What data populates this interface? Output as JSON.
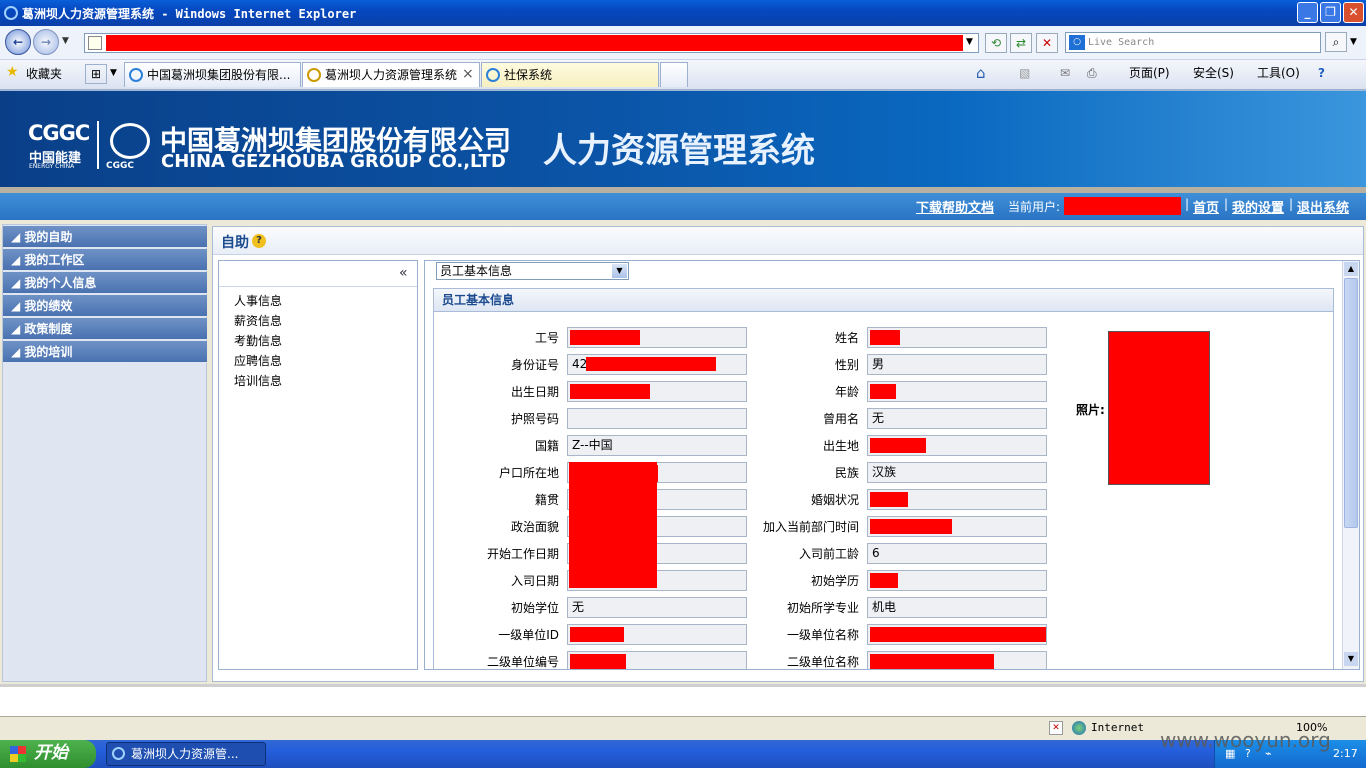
{
  "window": {
    "title": "葛洲坝人力资源管理系统 - Windows Internet Explorer",
    "minimize_icon": "minimize-icon",
    "maximize_icon": "maximize-icon",
    "close_icon": "close-icon"
  },
  "browser": {
    "search_placeholder": "Live Search",
    "favorites_label": "收藏夹",
    "tabs": [
      {
        "label": "中国葛洲坝集团股份有限..."
      },
      {
        "label": "葛洲坝人力资源管理系统"
      },
      {
        "label": "社保系统"
      }
    ],
    "tab_close": "×",
    "tools": {
      "page": "页面(P)",
      "safety": "安全(S)",
      "tools": "工具(O)"
    }
  },
  "header": {
    "logo_cgc": "CGGC",
    "energy_china_cn": "中国能建",
    "energy_china_en": "ENERGY CHINA",
    "cggc_small": "CGGC",
    "company_cn": "中国葛洲坝集团股份有限公司",
    "company_en": "CHINA GEZHOUBA GROUP CO.,LTD",
    "system_name": "人力资源管理系统"
  },
  "topnav": {
    "help_doc": "下载帮助文档",
    "current_user_label": "当前用户:",
    "home": "首页",
    "settings": "我的设置",
    "logout": "退出系统",
    "separator": "|"
  },
  "sidebar": {
    "items": [
      {
        "label": "我的自助"
      },
      {
        "label": "我的工作区"
      },
      {
        "label": "我的个人信息"
      },
      {
        "label": "我的绩效"
      },
      {
        "label": "政策制度"
      },
      {
        "label": "我的培训"
      }
    ]
  },
  "main": {
    "title": "自助",
    "collapse": "«",
    "submenu": [
      {
        "label": "人事信息"
      },
      {
        "label": "薪资信息"
      },
      {
        "label": "考勤信息"
      },
      {
        "label": "应聘信息"
      },
      {
        "label": "培训信息"
      }
    ],
    "select_value": "员工基本信息",
    "panel_title": "员工基本信息",
    "photo_label": "照片:",
    "left_fields": [
      {
        "label": "工号",
        "value": ""
      },
      {
        "label": "身份证号",
        "value": "42"
      },
      {
        "label": "出生日期",
        "value": ""
      },
      {
        "label": "护照号码",
        "value": ""
      },
      {
        "label": "国籍",
        "value": "Z--中国"
      },
      {
        "label": "户口所在地",
        "value": ""
      },
      {
        "label": "籍贯",
        "value": ""
      },
      {
        "label": "政治面貌",
        "value": ""
      },
      {
        "label": "开始工作日期",
        "value": ""
      },
      {
        "label": "入司日期",
        "value": ""
      },
      {
        "label": "初始学位",
        "value": "无"
      },
      {
        "label": "一级单位ID",
        "value": ""
      },
      {
        "label": "二级单位编号",
        "value": ""
      }
    ],
    "right_fields": [
      {
        "label": "姓名",
        "value": ""
      },
      {
        "label": "性别",
        "value": "男"
      },
      {
        "label": "年龄",
        "value": ""
      },
      {
        "label": "曾用名",
        "value": "无"
      },
      {
        "label": "出生地",
        "value": ""
      },
      {
        "label": "民族",
        "value": "汉族"
      },
      {
        "label": "婚姻状况",
        "value": ""
      },
      {
        "label": "加入当前部门时间",
        "value": ""
      },
      {
        "label": "入司前工龄",
        "value": "6"
      },
      {
        "label": "初始学历",
        "value": ""
      },
      {
        "label": "初始所学专业",
        "value": "机电"
      },
      {
        "label": "一级单位名称",
        "value": ""
      },
      {
        "label": "二级单位名称",
        "value": ""
      }
    ]
  },
  "statusbar": {
    "zone": "Internet",
    "zoom": "100%"
  },
  "taskbar": {
    "start": "开始",
    "task": "葛洲坝人力资源管...",
    "clock": "2:17"
  },
  "watermark": "www.wooyun.org"
}
